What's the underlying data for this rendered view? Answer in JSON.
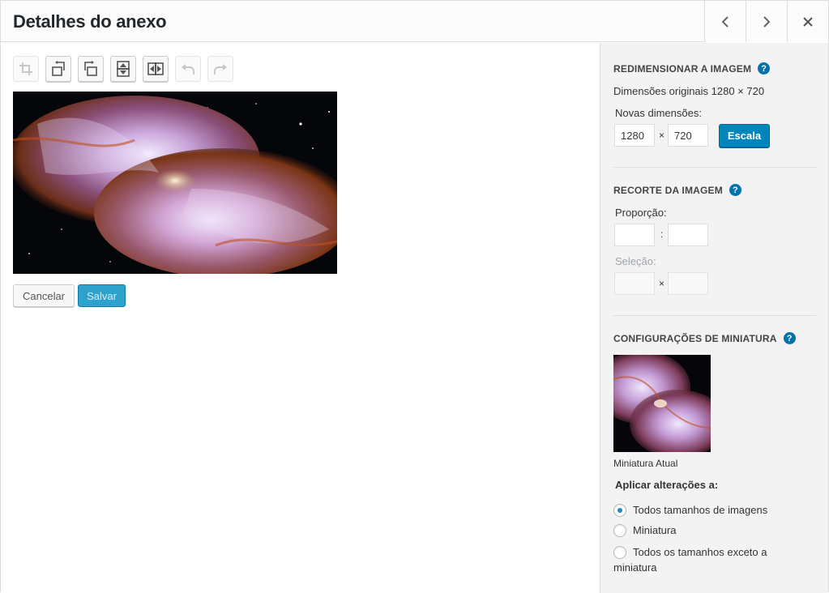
{
  "header": {
    "title": "Detalhes do anexo",
    "prev_label": "‹",
    "next_label": "›",
    "close_label": "×"
  },
  "toolbar": {
    "buttons": [
      {
        "name": "crop",
        "icon": "crop-icon",
        "enabled": false
      },
      {
        "name": "rotate-left",
        "icon": "rotate-left-icon",
        "enabled": true
      },
      {
        "name": "rotate-right",
        "icon": "rotate-right-icon",
        "enabled": true
      },
      {
        "name": "flip-vertical",
        "icon": "flip-vertical-icon",
        "enabled": true
      },
      {
        "name": "flip-horizontal",
        "icon": "flip-horizontal-icon",
        "enabled": true
      },
      {
        "name": "undo",
        "icon": "undo-icon",
        "enabled": false
      },
      {
        "name": "redo",
        "icon": "redo-icon",
        "enabled": false
      }
    ]
  },
  "editor": {
    "cancel_label": "Cancelar",
    "save_label": "Salvar"
  },
  "scale": {
    "title": "Redimensionar a imagem",
    "help": "?",
    "original_label": "Dimensões originais 1280 × 720",
    "new_label": "Novas dimensões:",
    "width_value": "1280",
    "height_value": "720",
    "times": "×",
    "button_label": "Escala"
  },
  "crop": {
    "title": "Recorte da imagem",
    "help": "?",
    "ratio_label": "Proporção:",
    "ratio_sep": ":",
    "ratio_w": "",
    "ratio_h": "",
    "selection_label": "Seleção:",
    "selection_sep": "×",
    "sel_w": "",
    "sel_h": ""
  },
  "thumbnail": {
    "title": "Configurações de miniatura",
    "help": "?",
    "current_label": "Miniatura Atual",
    "apply_label": "Aplicar alterações a:",
    "options": [
      {
        "label": "Todos tamanhos de imagens",
        "checked": true
      },
      {
        "label": "Miniatura",
        "checked": false
      },
      {
        "label": "Todos os tamanhos exceto a miniatura",
        "checked": false
      }
    ]
  },
  "colors": {
    "primary_button": "#0085ba",
    "save_button": "#2ea2cc",
    "help_icon": "#0073aa",
    "sidebar_bg": "#f3f3f3"
  }
}
